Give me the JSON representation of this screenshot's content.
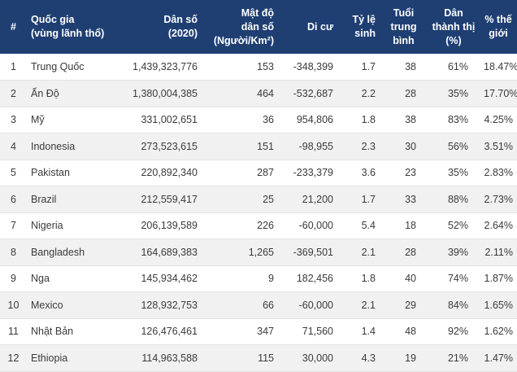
{
  "table": {
    "headers": {
      "index": "#",
      "country_l1": "Quốc gia",
      "country_l2": "(vùng lãnh thổ)",
      "population_l1": "Dân số",
      "population_l2": "(2020)",
      "density_l1": "Mật độ",
      "density_l2": "dân số",
      "density_l3": "(Người/Km²)",
      "migrants": "Di cư",
      "fertility_l1": "Tỷ lệ",
      "fertility_l2": "sinh",
      "median_age_l1": "Tuổi",
      "median_age_l2": "trung",
      "median_age_l3": "bình",
      "urban_l1": "Dân",
      "urban_l2": "thành thị",
      "urban_l3": "(%)",
      "world_share_l1": "% thế",
      "world_share_l2": "giới"
    },
    "rows": [
      {
        "index": "1",
        "country": "Trung Quốc",
        "population": "1,439,323,776",
        "density": "153",
        "migrants": "-348,399",
        "fertility": "1.7",
        "median_age": "38",
        "urban": "61%",
        "world_share": "18.47%"
      },
      {
        "index": "2",
        "country": "Ấn Độ",
        "population": "1,380,004,385",
        "density": "464",
        "migrants": "-532,687",
        "fertility": "2.2",
        "median_age": "28",
        "urban": "35%",
        "world_share": "17.70%"
      },
      {
        "index": "3",
        "country": "Mỹ",
        "population": "331,002,651",
        "density": "36",
        "migrants": "954,806",
        "fertility": "1.8",
        "median_age": "38",
        "urban": "83%",
        "world_share": "4.25%"
      },
      {
        "index": "4",
        "country": "Indonesia",
        "population": "273,523,615",
        "density": "151",
        "migrants": "-98,955",
        "fertility": "2.3",
        "median_age": "30",
        "urban": "56%",
        "world_share": "3.51%"
      },
      {
        "index": "5",
        "country": "Pakistan",
        "population": "220,892,340",
        "density": "287",
        "migrants": "-233,379",
        "fertility": "3.6",
        "median_age": "23",
        "urban": "35%",
        "world_share": "2.83%"
      },
      {
        "index": "6",
        "country": "Brazil",
        "population": "212,559,417",
        "density": "25",
        "migrants": "21,200",
        "fertility": "1.7",
        "median_age": "33",
        "urban": "88%",
        "world_share": "2.73%"
      },
      {
        "index": "7",
        "country": "Nigeria",
        "population": "206,139,589",
        "density": "226",
        "migrants": "-60,000",
        "fertility": "5.4",
        "median_age": "18",
        "urban": "52%",
        "world_share": "2.64%"
      },
      {
        "index": "8",
        "country": "Bangladesh",
        "population": "164,689,383",
        "density": "1,265",
        "migrants": "-369,501",
        "fertility": "2.1",
        "median_age": "28",
        "urban": "39%",
        "world_share": "2.11%"
      },
      {
        "index": "9",
        "country": "Nga",
        "population": "145,934,462",
        "density": "9",
        "migrants": "182,456",
        "fertility": "1.8",
        "median_age": "40",
        "urban": "74%",
        "world_share": "1.87%"
      },
      {
        "index": "10",
        "country": "Mexico",
        "population": "128,932,753",
        "density": "66",
        "migrants": "-60,000",
        "fertility": "2.1",
        "median_age": "29",
        "urban": "84%",
        "world_share": "1.65%"
      },
      {
        "index": "11",
        "country": "Nhật Bản",
        "population": "126,476,461",
        "density": "347",
        "migrants": "71,560",
        "fertility": "1.4",
        "median_age": "48",
        "urban": "92%",
        "world_share": "1.62%"
      },
      {
        "index": "12",
        "country": "Ethiopia",
        "population": "114,963,588",
        "density": "115",
        "migrants": "30,000",
        "fertility": "4.3",
        "median_age": "19",
        "urban": "21%",
        "world_share": "1.47%"
      }
    ]
  }
}
